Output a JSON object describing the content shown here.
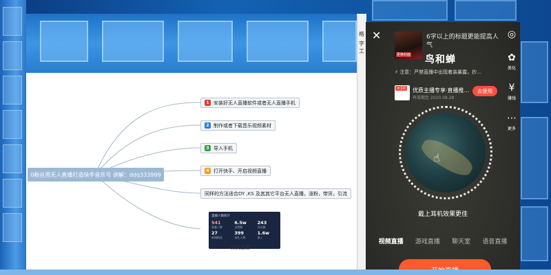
{
  "mindmap": {
    "root_label": "0粉丝用无人直播打造快手音乐号  讲解：ddq333999",
    "nodes": [
      {
        "num": "1",
        "color": "#e23b2f",
        "label": "安装好无人直播软件或者无人直播手机"
      },
      {
        "num": "2",
        "color": "#2b7fd6",
        "label": "制作或者下载音乐视频素材"
      },
      {
        "num": "3",
        "color": "#33a44a",
        "label": "导入手机"
      },
      {
        "num": "4",
        "color": "#f0a020",
        "label": "打开快手、开启视频直播"
      },
      {
        "num": "",
        "color": "",
        "label": "同样的方法适合DY ,KS  及其其它平台无人直播，涨粉，带货，引流"
      }
    ],
    "card_caption": "分支主题",
    "stats": {
      "title": "直播人数统计",
      "items": [
        {
          "num": "541",
          "label": "观看人数"
        },
        {
          "num": "6.5w",
          "label": "点赞数"
        },
        {
          "num": "243",
          "label": "评论数"
        },
        {
          "num": "27",
          "label": "新增粉丝"
        },
        {
          "num": "399",
          "label": "送礼人数"
        },
        {
          "num": "1.6w",
          "label": "收入"
        }
      ]
    }
  },
  "edge_panel": {
    "l1": "格",
    "l2": "字工"
  },
  "phone": {
    "title_hint": "6字以上的标题更能提高人气",
    "title_big": "鸟和蝉",
    "cover_caption": "更换封面",
    "notice": "注意：严禁直播中出现着装暴露，抄…",
    "tools": [
      {
        "icon": "camera-icon",
        "glyph": "◎",
        "label": ""
      },
      {
        "icon": "beauty-icon",
        "glyph": "✿",
        "label": "美化"
      },
      {
        "icon": "earn-icon",
        "glyph": "¥",
        "label": "赚钱"
      },
      {
        "icon": "more-icon",
        "glyph": "⋯",
        "label": "更多"
      }
    ],
    "coupon": {
      "badge": "×10",
      "title": "优质主播专享·直播推…",
      "date": "有效期至  2020.08.28",
      "button": "去使用"
    },
    "earphone_text": "戴上耳机效果更佳",
    "modes": [
      "视频直播",
      "游戏直播",
      "聊天室",
      "语音直播"
    ],
    "active_mode": 0,
    "start_button": "开始直播",
    "close_icon": "close-icon"
  }
}
